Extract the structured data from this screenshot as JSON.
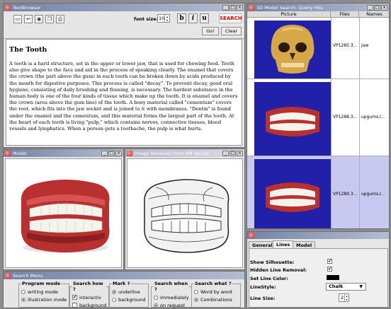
{
  "text_browser": {
    "title": "TextBrowser",
    "font_size_label": "font size:",
    "font_size_value": "10",
    "bold_label": "b",
    "italic_label": "i",
    "underline_label": "u",
    "search_label": "SEARCH",
    "go_label": "Go!",
    "clear_label": "Clear",
    "heading": "The Tooth",
    "body": "A tooth is a hard structure, set in the upper or lower jaw, that is used for chewing food. Teeth also give shape to the face and aid in the process of speaking clearly. The enamel that covers the crown (the part above the gum) in each tooth can be broken down by acids produced by the mouth for digestive purposes. This process is called \"decay\". To prevent decay, good oral hygiene, consisting of daily brushing and flossing, is necessary. The hardest substance in the human body is one of the four kinds of tissue which make up the tooth. It is enamel and covers the crown (area above the gum line) of the tooth. A bony material called \"cementum\" covers the root, which fits into the jaw socket and is joined to it with membranes. \"Dentin\" is found under the enamel and the cementum, and this material forms the largest part of the tooth. At the heart of each tooth is living \"pulp,\" which contains nerves, connective tissues, blood vessels and lymphatics. When a person gets a toothache, the pulp is what hurts."
  },
  "model_window": {
    "title": "Model"
  },
  "image_window": {
    "title": "Image Received from IPR Server"
  },
  "query_hits": {
    "title": "3D Model Search: Query Hits",
    "columns": [
      "Picture",
      "Files",
      "Names"
    ],
    "rows": [
      {
        "file": "VP1285.3...",
        "name": "jaw"
      },
      {
        "file": "VP1288.3...",
        "name": "upgums,l..."
      },
      {
        "file": "VP1289.3...",
        "name": "upgums,l..."
      }
    ]
  },
  "properties": {
    "tabs": [
      "General",
      "Lines",
      "Model"
    ],
    "active_tab": "Lines",
    "show_silhouette_label": "Show Silhouette:",
    "hidden_line_label": "Hidden Line Removal:",
    "line_color_label": "Set Line Color:",
    "line_style_label": "LineStyle:",
    "line_style_value": "Chalk",
    "line_size_label": "Line Size:",
    "line_size_value": "2",
    "check_mark": "✔"
  },
  "search_menu": {
    "title": "Search Menu",
    "groups": [
      {
        "legend": "Program mode",
        "options": [
          "writing mode",
          "illustration mode"
        ]
      },
      {
        "legend": "Search how ?",
        "options": [
          "interactiv",
          "background"
        ]
      },
      {
        "legend": "Mark ?",
        "options": [
          "underline",
          "background"
        ]
      },
      {
        "legend": "Search when ?",
        "options": [
          "immediately",
          "on request"
        ]
      },
      {
        "legend": "Search what ?",
        "options": [
          "Word by word",
          "Combinations"
        ]
      }
    ]
  },
  "window_controls": {
    "minimize": "_",
    "maximize": "□",
    "close": "x"
  },
  "colors": {
    "selected_row": "#c8c8f0",
    "picture_bg": "#2020a8",
    "search_red": "#e00000",
    "gum_red": "#b83030"
  }
}
